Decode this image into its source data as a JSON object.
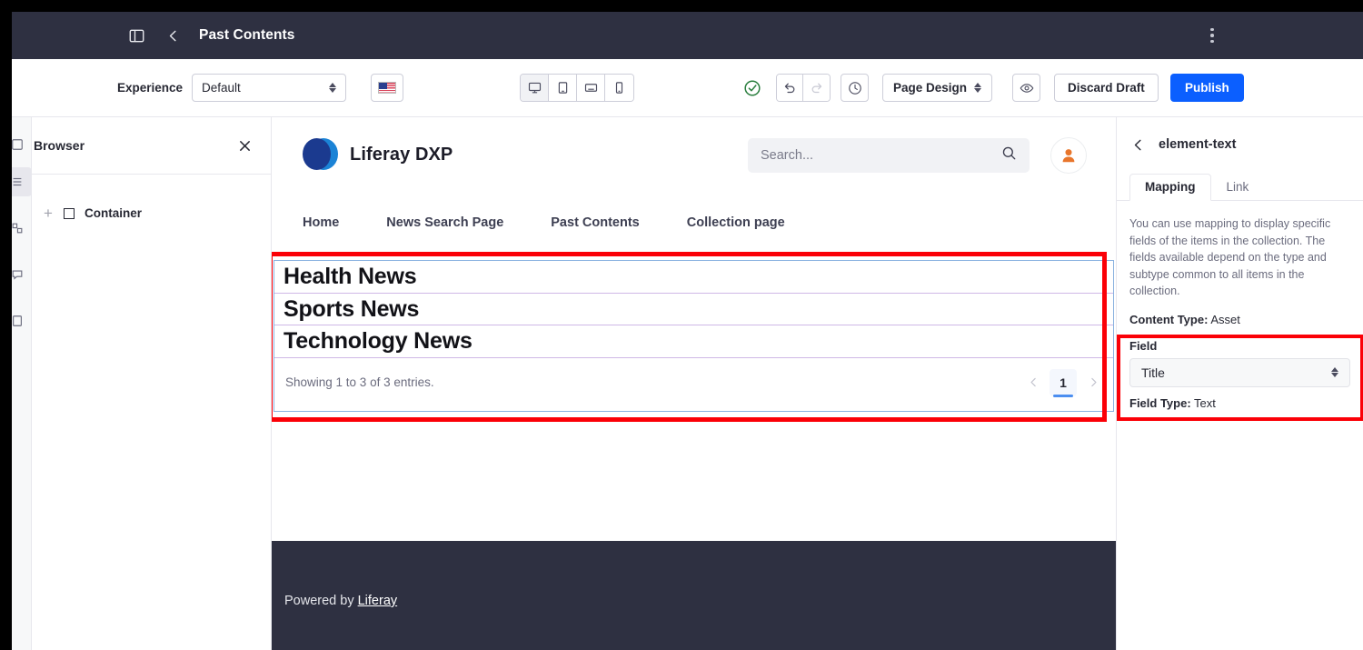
{
  "appbar": {
    "title": "Past Contents",
    "panel_toggle_icon": "sidebar-toggle-icon",
    "back_icon": "chevron-left-icon",
    "kebab_icon": "kebab-menu-icon"
  },
  "toolbar": {
    "experience_label": "Experience",
    "experience_value": "Default",
    "language_flag": "us-flag-icon",
    "devices": [
      {
        "name": "desktop",
        "icon": "desktop-icon",
        "active": true
      },
      {
        "name": "tablet",
        "icon": "tablet-icon",
        "active": false
      },
      {
        "name": "tablet-landscape",
        "icon": "tablet-landscape-icon",
        "active": false
      },
      {
        "name": "mobile",
        "icon": "mobile-icon",
        "active": false
      }
    ],
    "status_icon": "check-circle-icon",
    "undo_icon": "undo-icon",
    "redo_icon": "redo-icon",
    "history_icon": "clock-icon",
    "page_design_label": "Page Design",
    "preview_icon": "eye-icon",
    "discard_label": "Discard Draft",
    "publish_label": "Publish",
    "publish_color": "#0b5fff"
  },
  "browser_panel": {
    "title": "Browser",
    "close_icon": "close-icon",
    "tree": [
      {
        "label": "Container",
        "expand_icon": "plus-icon",
        "node_icon": "container-square-icon"
      }
    ]
  },
  "canvas": {
    "site_name": "Liferay DXP",
    "logo_icon": "liferay-logo-icon",
    "search_placeholder": "Search...",
    "search_icon": "search-icon",
    "avatar_icon": "user-avatar-icon",
    "nav": [
      {
        "label": "Home"
      },
      {
        "label": "News Search Page"
      },
      {
        "label": "Past Contents"
      },
      {
        "label": "Collection page"
      }
    ],
    "collection": {
      "items": [
        {
          "title": "Health News"
        },
        {
          "title": "Sports News"
        },
        {
          "title": "Technology News"
        }
      ],
      "showing_text": "Showing 1 to 3 of 3 entries.",
      "prev_icon": "chevron-left-icon",
      "next_icon": "chevron-right-icon",
      "current_page": "1",
      "highlight_color": "#fb0007",
      "border_color": "#8ab2e0"
    },
    "footer": {
      "prefix": "Powered by ",
      "link_label": "Liferay"
    }
  },
  "right_panel": {
    "back_icon": "chevron-left-icon",
    "title": "element-text",
    "tabs": [
      {
        "label": "Mapping",
        "active": true
      },
      {
        "label": "Link",
        "active": false
      }
    ],
    "description": "You can use mapping to display specific fields of the items in the collection. The fields available depend on the type and subtype common to all items in the collection.",
    "content_type_label": "Content Type:",
    "content_type_value": "Asset",
    "field_label": "Field",
    "field_value": "Title",
    "field_type_label": "Field Type:",
    "field_type_value": "Text",
    "highlight_color": "#fb0007"
  }
}
